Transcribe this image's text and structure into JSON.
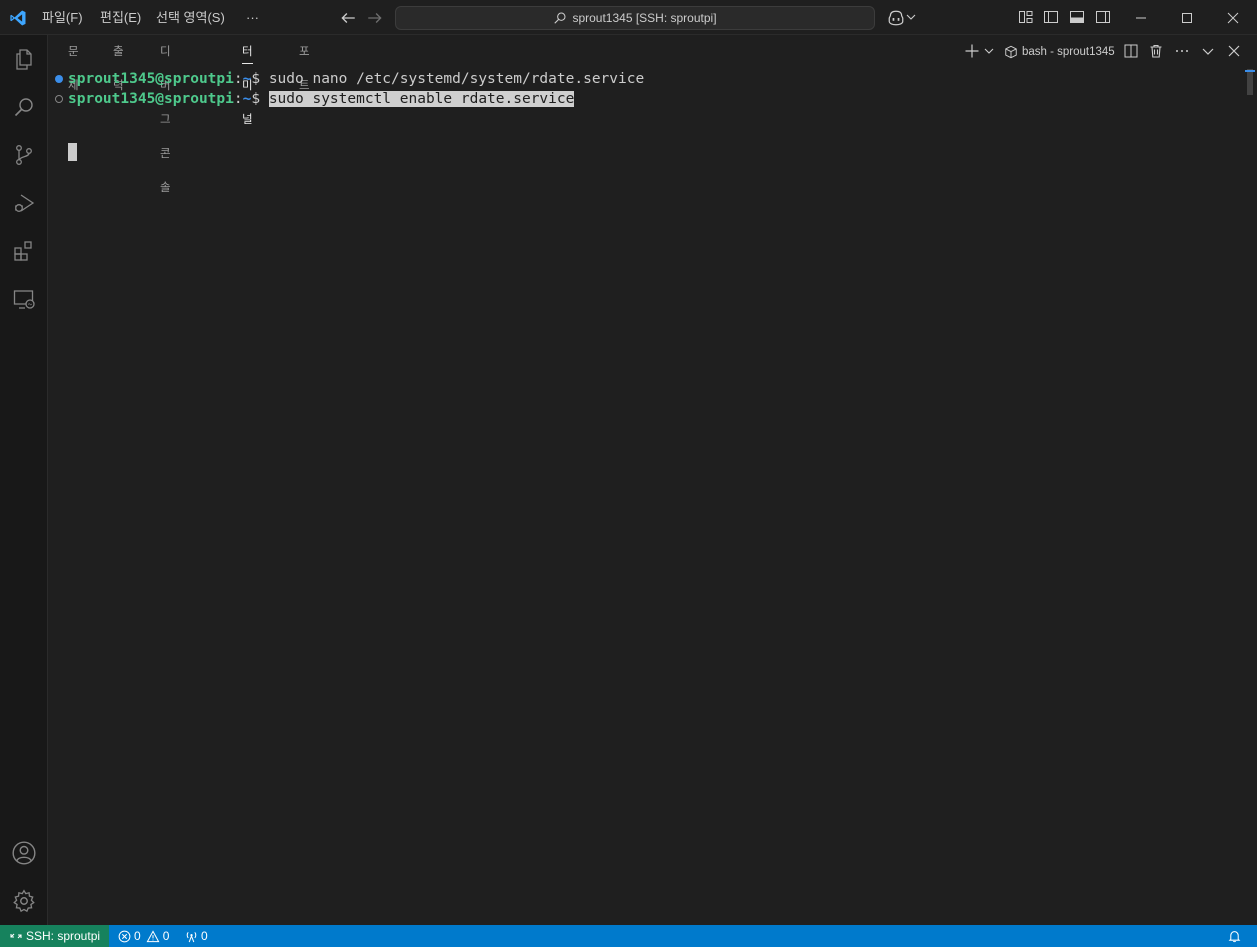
{
  "titlebar": {
    "menus": [
      "파일(F)",
      "편집(E)",
      "선택 영역(S)"
    ],
    "more": "···",
    "search_text": "sprout1345 [SSH: sproutpi]"
  },
  "panel": {
    "tabs": [
      "문제",
      "출력",
      "디버그 콘솔",
      "터미널",
      "포트"
    ],
    "active_tab": "터미널",
    "terminal_name": "bash - sprout1345"
  },
  "terminal": {
    "lines": [
      {
        "user": "sprout1345@sproutpi",
        "sep": ":",
        "path": "~",
        "dollar": "$ ",
        "command": "sudo nano /etc/systemd/system/rdate.service"
      },
      {
        "user": "sprout1345@sproutpi",
        "sep": ":",
        "path": "~",
        "dollar": "$ ",
        "command": "sudo systemctl enable rdate.service"
      }
    ]
  },
  "statusbar": {
    "remote": "SSH: sproutpi",
    "errors": "0",
    "warnings": "0",
    "ports": "0"
  },
  "colors": {
    "accent": "#007acc",
    "remote": "#16825d",
    "prompt_user": "#4ec98c",
    "prompt_path": "#3b8eea"
  }
}
